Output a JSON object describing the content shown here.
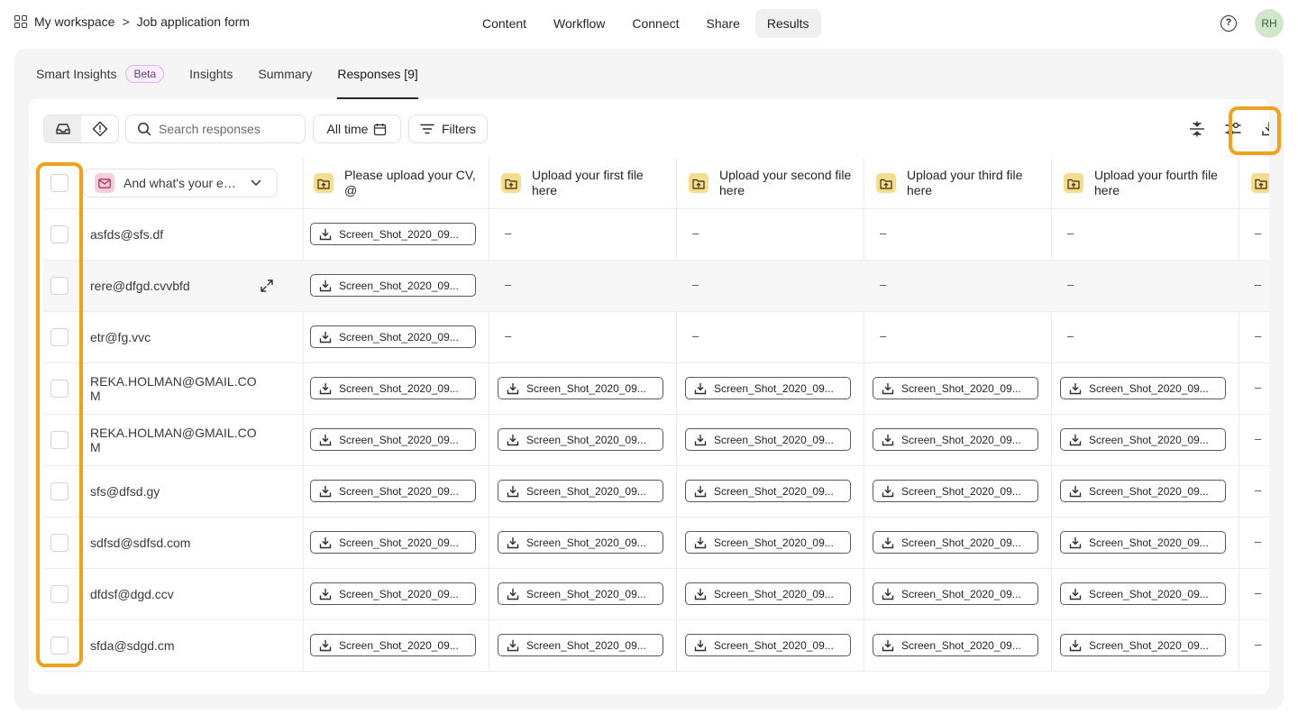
{
  "breadcrumb": {
    "workspace": "My workspace",
    "separator": ">",
    "form": "Job application form"
  },
  "top_nav": [
    "Content",
    "Workflow",
    "Connect",
    "Share",
    "Results"
  ],
  "top_nav_active": "Results",
  "help_label": "?",
  "avatar_initials": "RH",
  "sub_tabs": [
    {
      "label": "Smart Insights",
      "badge": "Beta"
    },
    {
      "label": "Insights"
    },
    {
      "label": "Summary"
    },
    {
      "label": "Responses [9]"
    }
  ],
  "sub_tab_active": "Responses [9]",
  "toolbar": {
    "search_placeholder": "Search responses",
    "time_label": "All time",
    "filters_label": "Filters"
  },
  "table": {
    "email_column_label": "And what's your e…",
    "columns": [
      "Please upload your CV, @",
      "Upload your first file here",
      "Upload your second file here",
      "Upload your third file here",
      "Upload your fourth file here"
    ],
    "empty_value": "–",
    "rows": [
      {
        "email": "asfds@sfs.df",
        "files": [
          "Screen_Shot_2020_09...",
          "–",
          "–",
          "–",
          "–",
          "–"
        ]
      },
      {
        "email": "rere@dfgd.cvvbfd",
        "files": [
          "Screen_Shot_2020_09...",
          "–",
          "–",
          "–",
          "–",
          "–"
        ]
      },
      {
        "email": "etr@fg.vvc",
        "files": [
          "Screen_Shot_2020_09...",
          "–",
          "–",
          "–",
          "–",
          "–"
        ]
      },
      {
        "email": "REKA.HOLMAN@GMAIL.COM",
        "files": [
          "Screen_Shot_2020_09...",
          "Screen_Shot_2020_09...",
          "Screen_Shot_2020_09...",
          "Screen_Shot_2020_09...",
          "Screen_Shot_2020_09...",
          "–"
        ]
      },
      {
        "email": "REKA.HOLMAN@GMAIL.COM",
        "files": [
          "Screen_Shot_2020_09...",
          "Screen_Shot_2020_09...",
          "Screen_Shot_2020_09...",
          "Screen_Shot_2020_09...",
          "Screen_Shot_2020_09...",
          "–"
        ]
      },
      {
        "email": "sfs@dfsd.gy",
        "files": [
          "Screen_Shot_2020_09...",
          "Screen_Shot_2020_09...",
          "Screen_Shot_2020_09...",
          "Screen_Shot_2020_09...",
          "Screen_Shot_2020_09...",
          "–"
        ]
      },
      {
        "email": "sdfsd@sdfsd.com",
        "files": [
          "Screen_Shot_2020_09...",
          "Screen_Shot_2020_09...",
          "Screen_Shot_2020_09...",
          "Screen_Shot_2020_09...",
          "Screen_Shot_2020_09...",
          "–"
        ]
      },
      {
        "email": "dfdsf@dgd.ccv",
        "files": [
          "Screen_Shot_2020_09...",
          "Screen_Shot_2020_09...",
          "Screen_Shot_2020_09...",
          "Screen_Shot_2020_09...",
          "Screen_Shot_2020_09...",
          "–"
        ]
      },
      {
        "email": "sfda@sdgd.cm",
        "files": [
          "Screen_Shot_2020_09...",
          "Screen_Shot_2020_09...",
          "Screen_Shot_2020_09...",
          "Screen_Shot_2020_09...",
          "Screen_Shot_2020_09...",
          "–"
        ]
      }
    ]
  },
  "colors": {
    "highlight": "#f5a117",
    "file_icon_bg": "#f6dc8c",
    "email_icon_bg": "#f6cfd8",
    "beta_border": "#d8b8ea"
  }
}
